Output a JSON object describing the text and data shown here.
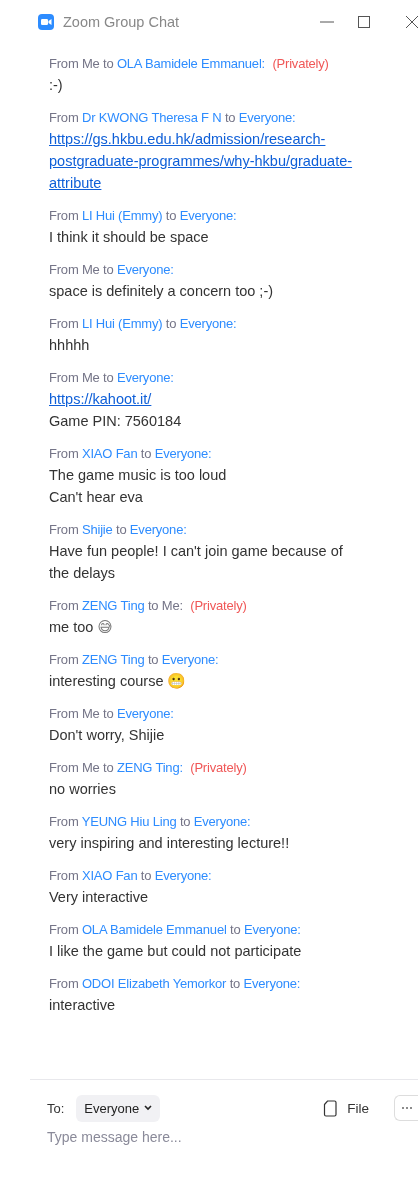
{
  "window": {
    "title": "Zoom Group Chat"
  },
  "messages": [
    {
      "header": [
        {
          "text": "From",
          "kind": "plain"
        },
        {
          "text": "Me",
          "kind": "plain"
        },
        {
          "text": "to",
          "kind": "plain"
        },
        {
          "text": "OLA Bamidele Emmanuel:",
          "kind": "name"
        },
        {
          "text": "(Privately)",
          "kind": "private"
        }
      ],
      "lines": [
        {
          "text": ":-)",
          "kind": "text"
        }
      ]
    },
    {
      "header": [
        {
          "text": "From",
          "kind": "plain"
        },
        {
          "text": "Dr KWONG Theresa F N",
          "kind": "name"
        },
        {
          "text": "to",
          "kind": "plain"
        },
        {
          "text": "Everyone:",
          "kind": "name"
        }
      ],
      "lines": [
        {
          "text": "https://gs.hkbu.edu.hk/admission/research-postgraduate-programmes/why-hkbu/graduate-attribute",
          "kind": "link"
        }
      ]
    },
    {
      "header": [
        {
          "text": "From",
          "kind": "plain"
        },
        {
          "text": "LI Hui (Emmy)",
          "kind": "name"
        },
        {
          "text": "to",
          "kind": "plain"
        },
        {
          "text": "Everyone:",
          "kind": "name"
        }
      ],
      "lines": [
        {
          "text": "I think it should be space",
          "kind": "text"
        }
      ]
    },
    {
      "header": [
        {
          "text": "From",
          "kind": "plain"
        },
        {
          "text": "Me",
          "kind": "plain"
        },
        {
          "text": "to",
          "kind": "plain"
        },
        {
          "text": "Everyone:",
          "kind": "name"
        }
      ],
      "lines": [
        {
          "text": "space is definitely a concern too ;-)",
          "kind": "text"
        }
      ]
    },
    {
      "header": [
        {
          "text": "From",
          "kind": "plain"
        },
        {
          "text": "LI Hui (Emmy)",
          "kind": "name"
        },
        {
          "text": "to",
          "kind": "plain"
        },
        {
          "text": "Everyone:",
          "kind": "name"
        }
      ],
      "lines": [
        {
          "text": "hhhhh",
          "kind": "text"
        }
      ]
    },
    {
      "header": [
        {
          "text": "From",
          "kind": "plain"
        },
        {
          "text": "Me",
          "kind": "plain"
        },
        {
          "text": "to",
          "kind": "plain"
        },
        {
          "text": "Everyone:",
          "kind": "name"
        }
      ],
      "lines": [
        {
          "text": "https://kahoot.it/",
          "kind": "link"
        },
        {
          "text": "Game PIN: 7560184",
          "kind": "text"
        }
      ]
    },
    {
      "header": [
        {
          "text": "From",
          "kind": "plain"
        },
        {
          "text": "XIAO Fan",
          "kind": "name"
        },
        {
          "text": "to",
          "kind": "plain"
        },
        {
          "text": "Everyone:",
          "kind": "name"
        }
      ],
      "lines": [
        {
          "text": "The game music is too loud",
          "kind": "text"
        },
        {
          "text": "Can't hear eva",
          "kind": "text"
        }
      ]
    },
    {
      "header": [
        {
          "text": "From",
          "kind": "plain"
        },
        {
          "text": "Shijie",
          "kind": "name"
        },
        {
          "text": "to",
          "kind": "plain"
        },
        {
          "text": "Everyone:",
          "kind": "name"
        }
      ],
      "lines": [
        {
          "text": "Have fun people! I can't join game because of the delays",
          "kind": "text"
        }
      ]
    },
    {
      "header": [
        {
          "text": "From",
          "kind": "plain"
        },
        {
          "text": "ZENG Ting",
          "kind": "name"
        },
        {
          "text": "to",
          "kind": "plain"
        },
        {
          "text": "Me:",
          "kind": "plain"
        },
        {
          "text": "(Privately)",
          "kind": "private"
        }
      ],
      "lines": [
        {
          "text": "me too",
          "kind": "text",
          "emoji": "😅"
        }
      ]
    },
    {
      "header": [
        {
          "text": "From",
          "kind": "plain"
        },
        {
          "text": "ZENG Ting",
          "kind": "name"
        },
        {
          "text": "to",
          "kind": "plain"
        },
        {
          "text": "Everyone:",
          "kind": "name"
        }
      ],
      "lines": [
        {
          "text": "interesting course",
          "kind": "text",
          "emoji": "😬"
        }
      ]
    },
    {
      "header": [
        {
          "text": "From",
          "kind": "plain"
        },
        {
          "text": "Me",
          "kind": "plain"
        },
        {
          "text": "to",
          "kind": "plain"
        },
        {
          "text": "Everyone:",
          "kind": "name"
        }
      ],
      "lines": [
        {
          "text": "Don't worry, Shijie",
          "kind": "text"
        }
      ]
    },
    {
      "header": [
        {
          "text": "From",
          "kind": "plain"
        },
        {
          "text": "Me",
          "kind": "plain"
        },
        {
          "text": "to",
          "kind": "plain"
        },
        {
          "text": "ZENG Ting:",
          "kind": "name"
        },
        {
          "text": "(Privately)",
          "kind": "private"
        }
      ],
      "lines": [
        {
          "text": "no worries",
          "kind": "text"
        }
      ]
    },
    {
      "header": [
        {
          "text": "From",
          "kind": "plain"
        },
        {
          "text": "YEUNG Hiu Ling",
          "kind": "name"
        },
        {
          "text": "to",
          "kind": "plain"
        },
        {
          "text": "Everyone:",
          "kind": "name"
        }
      ],
      "lines": [
        {
          "text": "very inspiring and interesting lecture!!",
          "kind": "text"
        }
      ]
    },
    {
      "header": [
        {
          "text": "From",
          "kind": "plain"
        },
        {
          "text": "XIAO Fan",
          "kind": "name"
        },
        {
          "text": "to",
          "kind": "plain"
        },
        {
          "text": "Everyone:",
          "kind": "name"
        }
      ],
      "lines": [
        {
          "text": "Very interactive",
          "kind": "text"
        }
      ]
    },
    {
      "header": [
        {
          "text": "From",
          "kind": "plain"
        },
        {
          "text": "OLA Bamidele Emmanuel",
          "kind": "name"
        },
        {
          "text": "to",
          "kind": "plain"
        },
        {
          "text": "Everyone:",
          "kind": "name"
        }
      ],
      "lines": [
        {
          "text": "I like the game but could not participate",
          "kind": "text"
        }
      ]
    },
    {
      "header": [
        {
          "text": "From",
          "kind": "plain"
        },
        {
          "text": "ODOI Elizabeth Yemorkor",
          "kind": "name"
        },
        {
          "text": "to",
          "kind": "plain"
        },
        {
          "text": "Everyone:",
          "kind": "name"
        }
      ],
      "lines": [
        {
          "text": "interactive",
          "kind": "text"
        }
      ]
    }
  ],
  "composer": {
    "to_label": "To:",
    "recipient": "Everyone",
    "file_label": "File",
    "placeholder": "Type message here..."
  }
}
